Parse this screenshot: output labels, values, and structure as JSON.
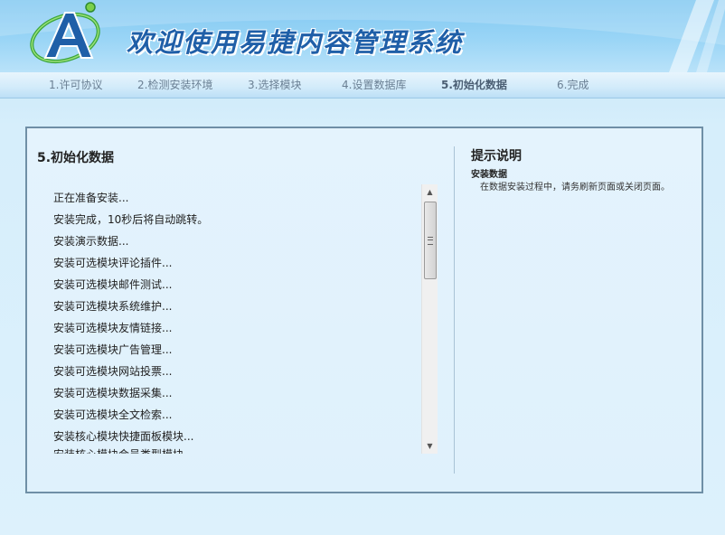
{
  "header": {
    "title": "欢迎使用易捷内容管理系统",
    "logo_icon": "letter-a-orbit-logo",
    "accent_color": "#1f5fa8"
  },
  "steps": [
    {
      "label": "1.许可协议",
      "active": false
    },
    {
      "label": "2.检测安装环境",
      "active": false
    },
    {
      "label": "3.选择模块",
      "active": false
    },
    {
      "label": "4.设置数据库",
      "active": false
    },
    {
      "label": "5.初始化数据",
      "active": true
    },
    {
      "label": "6.完成",
      "active": false
    }
  ],
  "main": {
    "section_title": "5.初始化数据",
    "log": [
      "正在准备安装...",
      "安装完成，10秒后将自动跳转。",
      "安装演示数据...",
      "安装可选模块评论插件...",
      "安装可选模块邮件测试...",
      "安装可选模块系统维护...",
      "安装可选模块友情链接...",
      "安装可选模块广告管理...",
      "安装可选模块网站投票...",
      "安装可选模块数据采集...",
      "安装可选模块全文检索...",
      "安装核心模块快捷面板模块...",
      "安装核心模块会员类型模块..."
    ]
  },
  "hint": {
    "title": "提示说明",
    "subtitle": "安装数据",
    "text": "在数据安装过程中，请务刷新页面或关闭页面。"
  }
}
